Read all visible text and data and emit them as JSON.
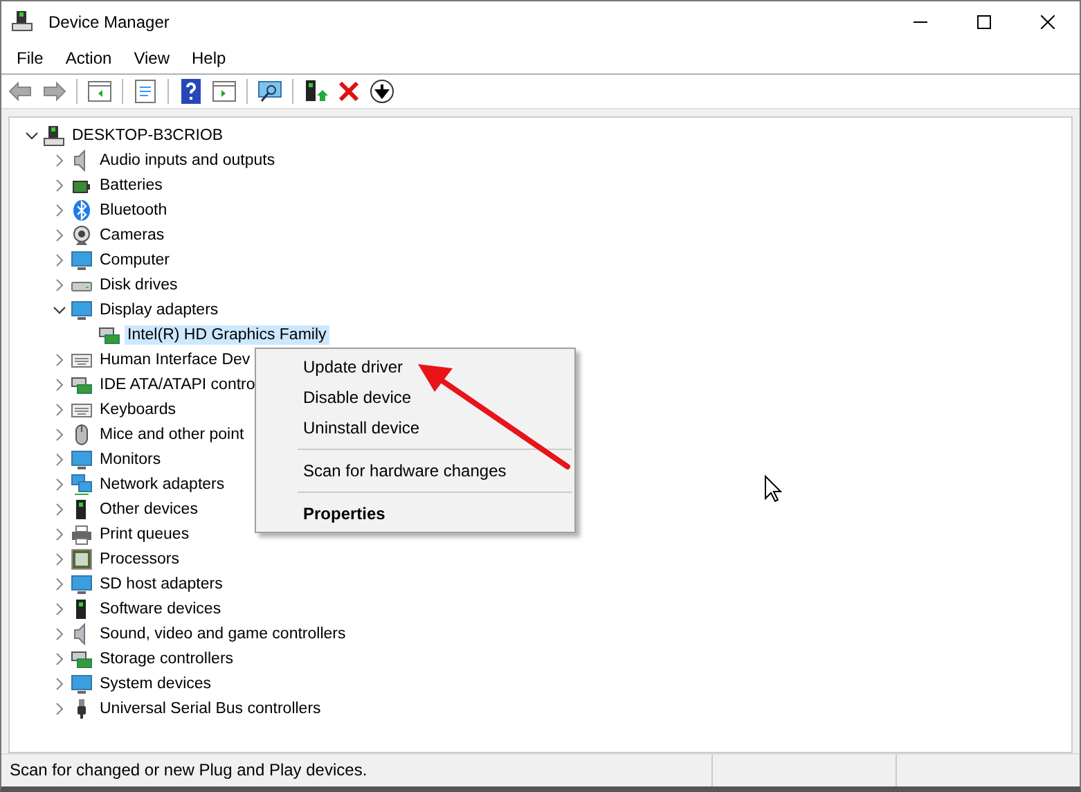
{
  "window": {
    "title": "Device Manager"
  },
  "menu_bar": [
    "File",
    "Action",
    "View",
    "Help"
  ],
  "tree": {
    "label": "DESKTOP-B3CRIOB",
    "expanded": true,
    "selected": false,
    "children": [
      {
        "label": "Audio inputs and outputs",
        "expanded": false,
        "selected": false
      },
      {
        "label": "Batteries",
        "expanded": false,
        "selected": false
      },
      {
        "label": "Bluetooth",
        "expanded": false,
        "selected": false
      },
      {
        "label": "Cameras",
        "expanded": false,
        "selected": false
      },
      {
        "label": "Computer",
        "expanded": false,
        "selected": false
      },
      {
        "label": "Disk drives",
        "expanded": false,
        "selected": false
      },
      {
        "label": "Display adapters",
        "expanded": true,
        "selected": false,
        "children": [
          {
            "label": "Intel(R) HD Graphics Family",
            "selected": true
          }
        ]
      },
      {
        "label": "Human Interface Dev",
        "expanded": false,
        "selected": false
      },
      {
        "label": "IDE ATA/ATAPI contro",
        "expanded": false,
        "selected": false
      },
      {
        "label": "Keyboards",
        "expanded": false,
        "selected": false
      },
      {
        "label": "Mice and other point",
        "expanded": false,
        "selected": false
      },
      {
        "label": "Monitors",
        "expanded": false,
        "selected": false
      },
      {
        "label": "Network adapters",
        "expanded": false,
        "selected": false
      },
      {
        "label": "Other devices",
        "expanded": false,
        "selected": false
      },
      {
        "label": "Print queues",
        "expanded": false,
        "selected": false
      },
      {
        "label": "Processors",
        "expanded": false,
        "selected": false
      },
      {
        "label": "SD host adapters",
        "expanded": false,
        "selected": false
      },
      {
        "label": "Software devices",
        "expanded": false,
        "selected": false
      },
      {
        "label": "Sound, video and game controllers",
        "expanded": false,
        "selected": false
      },
      {
        "label": "Storage controllers",
        "expanded": false,
        "selected": false
      },
      {
        "label": "System devices",
        "expanded": false,
        "selected": false
      },
      {
        "label": "Universal Serial Bus controllers",
        "expanded": false,
        "selected": false
      }
    ]
  },
  "context_menu": {
    "items": [
      {
        "kind": "item",
        "label": "Update driver"
      },
      {
        "kind": "item",
        "label": "Disable device"
      },
      {
        "kind": "item",
        "label": "Uninstall device"
      },
      {
        "kind": "separator"
      },
      {
        "kind": "item",
        "label": "Scan for hardware changes"
      },
      {
        "kind": "separator"
      },
      {
        "kind": "default",
        "label": "Properties"
      }
    ]
  },
  "status_bar": "Scan for changed or new Plug and Play devices."
}
